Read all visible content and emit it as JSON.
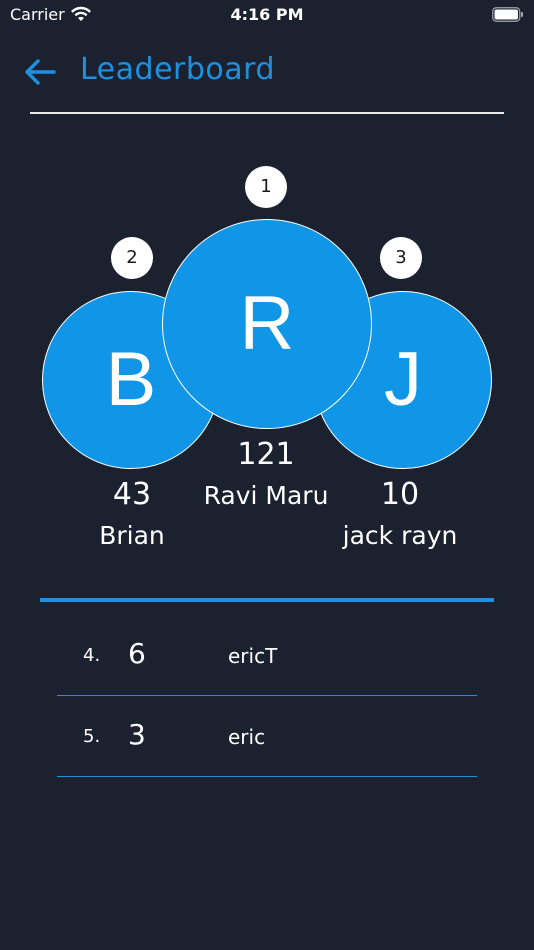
{
  "status_bar": {
    "carrier": "Carrier",
    "time": "4:16 PM"
  },
  "header": {
    "title": "Leaderboard"
  },
  "podium": {
    "first": {
      "rank": "1",
      "initial": "R",
      "score": "121",
      "name": "Ravi Maru"
    },
    "second": {
      "rank": "2",
      "initial": "B",
      "score": "43",
      "name": "Brian"
    },
    "third": {
      "rank": "3",
      "initial": "J",
      "score": "10",
      "name": "jack rayn"
    }
  },
  "list": [
    {
      "rank": "4.",
      "score": "6",
      "name": "ericT"
    },
    {
      "rank": "5.",
      "score": "3",
      "name": "eric"
    }
  ],
  "colors": {
    "background": "#1c2130",
    "accent": "#1e90e0",
    "avatar": "#1195e6"
  }
}
